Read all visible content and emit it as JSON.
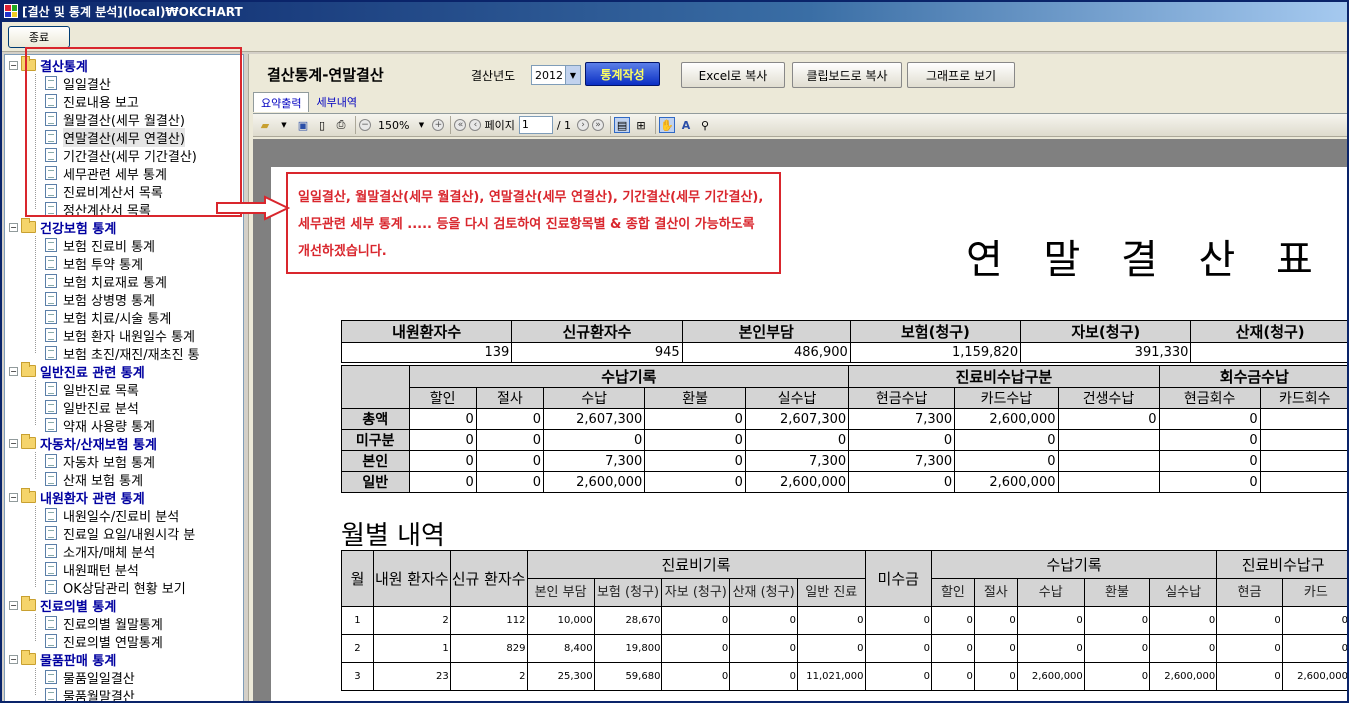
{
  "window": {
    "title": "[결산 및 통계 분석](local)₩OKCHART"
  },
  "topbar": {
    "exit_label": "종료"
  },
  "tree": {
    "categories": [
      {
        "label": "결산통계",
        "items": [
          "일일결산",
          "진료내용 보고",
          "월말결산(세무 월결산)",
          "연말결산(세무 연결산)",
          "기간결산(세무 기간결산)",
          "세무관련 세부 통계",
          "진료비계산서 목록",
          "정산계산서 목록"
        ]
      },
      {
        "label": "건강보험 통계",
        "items": [
          "보험 진료비 통계",
          "보험 투약 통계",
          "보험 치료재료 통계",
          "보험 상병명 통계",
          "보험 치료/시술 통계",
          "보험 환자 내원일수 통계",
          "보험 초진/재진/재초진 통"
        ]
      },
      {
        "label": "일반진료 관련 통계",
        "items": [
          "일반진료 목록",
          "일반진료 분석",
          "약재 사용량 통계"
        ]
      },
      {
        "label": "자동차/산재보험 통계",
        "items": [
          "자동차 보험 통계",
          "산재 보험 통계"
        ]
      },
      {
        "label": "내원환자 관련 통계",
        "items": [
          "내원일수/진료비 분석",
          "진료일 요일/내원시각 분",
          "소개자/매체 분석",
          "내원패턴 분석",
          "OK상담관리 현황 보기"
        ]
      },
      {
        "label": "진료의별 통계",
        "items": [
          "진료의별 월말통계",
          "진료의별 연말통계"
        ]
      },
      {
        "label": "물품판매 통계",
        "items": [
          "물품일일결산",
          "물품월말결산"
        ]
      }
    ],
    "selected": "연말결산(세무 연결산)"
  },
  "header": {
    "title": "결산통계-연말결산",
    "year_label": "결산년도",
    "year_value": "2012",
    "generate_label": "통계작성",
    "excel_copy": "Excel로 복사",
    "clipboard_copy": "클립보드로 복사",
    "graph_view": "그래프로 보기"
  },
  "tabs": [
    "요약출력",
    "세부내역"
  ],
  "viewer_toolbar": {
    "zoom": "150%",
    "page_label": "페이지",
    "page_current": "1",
    "page_total": "/ 1"
  },
  "annotation": {
    "text": "일일결산, 월말결산(세무 월결산), 연말결산(세무 연결산), 기간결산(세무 기간결산), 세무관련 세부 통계 ..... 등을 다시 검토하여 진료항목별 & 종합 결산이 가능하도록 개선하겠습니다."
  },
  "report": {
    "title": "연 말  결 산 표",
    "summary": {
      "headers": [
        "내원환자수",
        "신규환자수",
        "본인부담",
        "보험(청구)",
        "자보(청구)",
        "산재(청구)"
      ],
      "values": [
        "139",
        "945",
        "486,900",
        "1,159,820",
        "391,330",
        ""
      ]
    },
    "receipts": {
      "group_headers": [
        "수납기록",
        "진료비수납구분",
        "회수금수납"
      ],
      "sub_headers": [
        "할인",
        "절사",
        "수납",
        "환불",
        "실수납",
        "현금수납",
        "카드수납",
        "건생수납",
        "현금회수",
        "카드회수"
      ],
      "rows": [
        {
          "label": "총액",
          "values": [
            "0",
            "0",
            "2,607,300",
            "0",
            "2,607,300",
            "7,300",
            "2,600,000",
            "0",
            "0",
            ""
          ]
        },
        {
          "label": "미구분",
          "values": [
            "0",
            "0",
            "0",
            "0",
            "0",
            "0",
            "0",
            "",
            "0",
            ""
          ]
        },
        {
          "label": "본인",
          "values": [
            "0",
            "0",
            "7,300",
            "0",
            "7,300",
            "7,300",
            "0",
            "",
            "0",
            ""
          ]
        },
        {
          "label": "일반",
          "values": [
            "0",
            "0",
            "2,600,000",
            "0",
            "2,600,000",
            "0",
            "2,600,000",
            "",
            "0",
            ""
          ]
        }
      ]
    },
    "monthly": {
      "title": "월별 내역",
      "headers": {
        "month": "월",
        "visits": "내원 환자수",
        "new": "신규 환자수",
        "treatment_group": "진료비기록",
        "treatment": [
          "본인 부담",
          "보험 (청구)",
          "자보 (청구)",
          "산재 (청구)",
          "일반 진료"
        ],
        "unpaid": "미수금",
        "receipt_group": "수납기록",
        "receipt": [
          "할인",
          "절사",
          "수납",
          "환불",
          "실수납"
        ],
        "division_group": "진료비수납구",
        "division": [
          "현금",
          "카드"
        ]
      },
      "rows": [
        [
          "1",
          "2",
          "112",
          "10,000",
          "28,670",
          "0",
          "0",
          "0",
          "0",
          "0",
          "0",
          "0",
          "0",
          "0",
          "0",
          "0"
        ],
        [
          "2",
          "1",
          "829",
          "8,400",
          "19,800",
          "0",
          "0",
          "0",
          "0",
          "0",
          "0",
          "0",
          "0",
          "0",
          "0",
          "0"
        ],
        [
          "3",
          "23",
          "2",
          "25,300",
          "59,680",
          "0",
          "0",
          "11,021,000",
          "0",
          "0",
          "0",
          "2,600,000",
          "0",
          "2,600,000",
          "0",
          "2,600,000"
        ]
      ]
    }
  }
}
